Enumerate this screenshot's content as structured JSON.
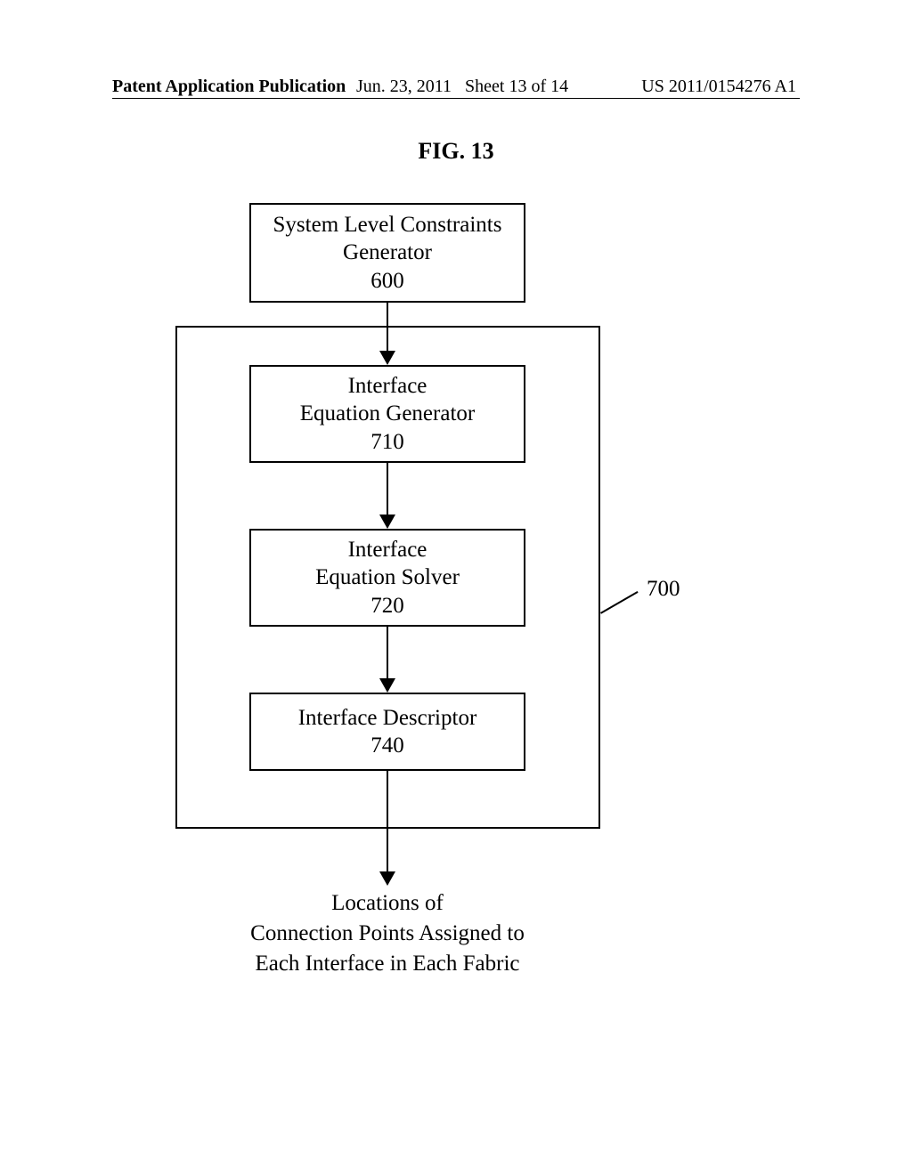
{
  "header": {
    "left": "Patent Application Publication",
    "date": "Jun. 23, 2011",
    "sheet": "Sheet 13 of 14",
    "docnum": "US 2011/0154276 A1"
  },
  "figure": {
    "title": "FIG. 13",
    "box600": {
      "line1": "System Level Constraints",
      "line2": "Generator",
      "num": "600"
    },
    "box710": {
      "line1": "Interface",
      "line2": "Equation Generator",
      "num": "710"
    },
    "box720": {
      "line1": "Interface",
      "line2": "Equation Solver",
      "num": "720"
    },
    "box740": {
      "line1": "Interface Descriptor",
      "num": "740"
    },
    "container_ref": "700",
    "output": {
      "line1": "Locations of",
      "line2": "Connection Points Assigned to",
      "line3": "Each Interface in Each Fabric"
    }
  }
}
